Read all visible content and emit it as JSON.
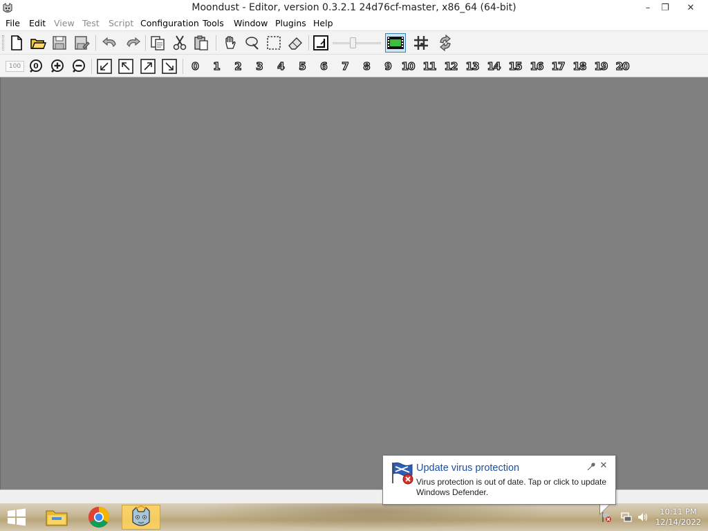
{
  "window": {
    "title": "Moondust - Editor, version 0.3.2.1 24d76cf-master, x86_64 (64-bit)",
    "minimize_glyph": "–",
    "restore_glyph": "❐",
    "close_glyph": "✕"
  },
  "menu": {
    "items": [
      {
        "label": "File",
        "enabled": true
      },
      {
        "label": "Edit",
        "enabled": true
      },
      {
        "label": "View",
        "enabled": false
      },
      {
        "label": "Test",
        "enabled": false
      },
      {
        "label": "Script",
        "enabled": false
      },
      {
        "label": "Configuration",
        "enabled": true
      },
      {
        "label": "Tools",
        "enabled": true
      },
      {
        "label": "Window",
        "enabled": true
      },
      {
        "label": "Plugins",
        "enabled": true
      },
      {
        "label": "Help",
        "enabled": true
      }
    ]
  },
  "toolbar": {
    "zoom_value": "100",
    "layers": [
      "0",
      "1",
      "2",
      "3",
      "4",
      "5",
      "6",
      "7",
      "8",
      "9",
      "10",
      "11",
      "12",
      "13",
      "14",
      "15",
      "16",
      "17",
      "18",
      "19",
      "20"
    ]
  },
  "taskbar": {
    "clock_time": "10:11 PM",
    "clock_date": "12/14/2022",
    "active_app": "moondust-editor"
  },
  "notification": {
    "title": "Update virus protection",
    "message": "Virus protection is out of date. Tap or click to update Windows Defender.",
    "close_glyph": "✕"
  },
  "colors": {
    "workspace": "#808080",
    "notification_title": "#1d4f9c",
    "taskbar_active": "#ffd25a"
  }
}
